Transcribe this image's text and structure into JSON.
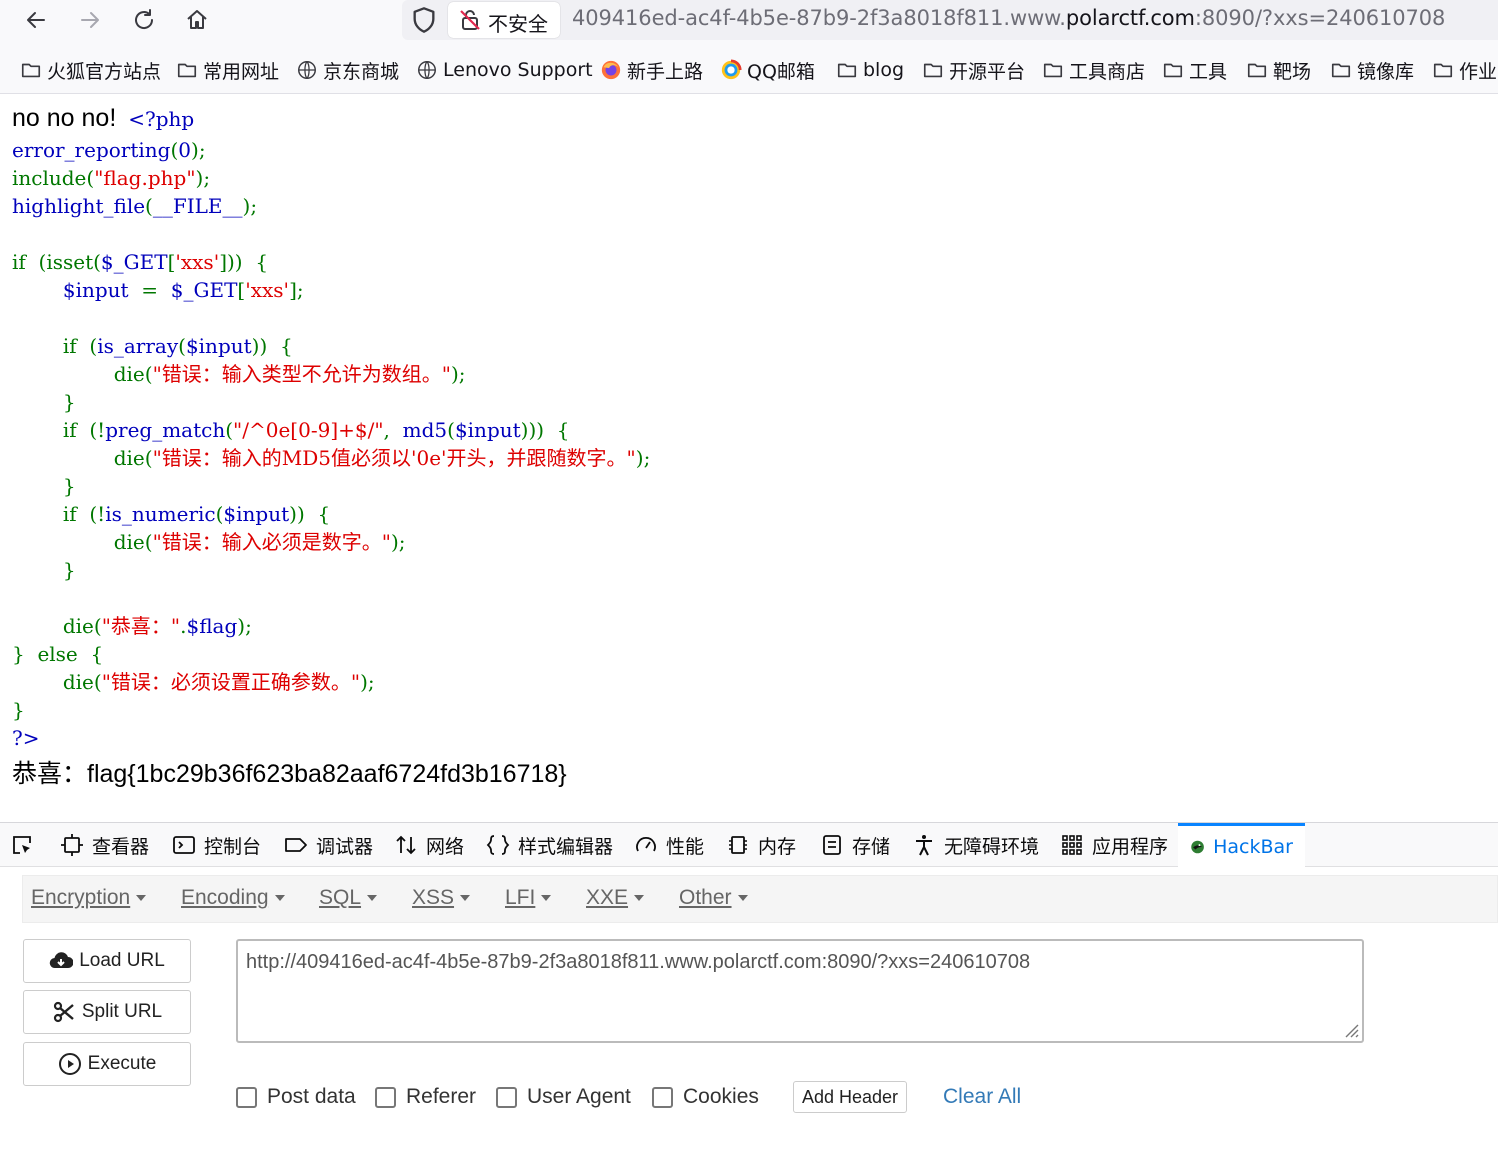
{
  "browser": {
    "security_label": "不安全",
    "url_prefix": "409416ed-ac4f-4b5e-87b9-2f3a8018f811.www.",
    "url_host": "polarctf.com",
    "url_suffix": ":8090/?xxs=240610708",
    "bookmarks": [
      {
        "label": "火狐官方站点",
        "icon": "folder-icon"
      },
      {
        "label": "常用网址",
        "icon": "folder-icon"
      },
      {
        "label": "京东商城",
        "icon": "globe-icon"
      },
      {
        "label": "Lenovo Support",
        "icon": "globe-icon"
      },
      {
        "label": "新手上路",
        "icon": "firefox-icon"
      },
      {
        "label": "QQ邮箱",
        "icon": "qq-mail-icon"
      },
      {
        "label": "blog",
        "icon": "folder-icon"
      },
      {
        "label": "开源平台",
        "icon": "folder-icon"
      },
      {
        "label": "工具商店",
        "icon": "folder-icon"
      },
      {
        "label": "工具",
        "icon": "folder-icon"
      },
      {
        "label": "靶场",
        "icon": "folder-icon"
      },
      {
        "label": "镜像库",
        "icon": "folder-icon"
      },
      {
        "label": "作业",
        "icon": "folder-icon"
      }
    ]
  },
  "page": {
    "lead": "no no no!",
    "flag_line": "恭喜：flag{1bc29b36f623ba82aaf6724fd3b16718}",
    "colors": {
      "keyword": "#0000bb",
      "operator": "#007700",
      "string": "#dd0000"
    }
  },
  "devtools": {
    "tabs": [
      {
        "label": "",
        "icon": "element-picker-icon"
      },
      {
        "label": "查看器",
        "icon": "inspector-icon"
      },
      {
        "label": "控制台",
        "icon": "console-icon"
      },
      {
        "label": "调试器",
        "icon": "debugger-icon"
      },
      {
        "label": "网络",
        "icon": "network-icon"
      },
      {
        "label": "样式编辑器",
        "icon": "style-editor-icon"
      },
      {
        "label": "性能",
        "icon": "performance-icon"
      },
      {
        "label": "内存",
        "icon": "memory-icon"
      },
      {
        "label": "存储",
        "icon": "storage-icon"
      },
      {
        "label": "无障碍环境",
        "icon": "accessibility-icon"
      },
      {
        "label": "应用程序",
        "icon": "application-icon"
      },
      {
        "label": "HackBar",
        "icon": "hackbar-icon"
      }
    ],
    "hackbar": {
      "menu": [
        "Encryption",
        "Encoding",
        "SQL",
        "XSS",
        "LFI",
        "XXE",
        "Other"
      ],
      "load_url": "Load URL",
      "split_url": "Split URL",
      "execute": "Execute",
      "url_value": "http://409416ed-ac4f-4b5e-87b9-2f3a8018f811.www.polarctf.com:8090/?xxs=240610708",
      "options": [
        "Post data",
        "Referer",
        "User Agent",
        "Cookies"
      ],
      "add_header": "Add Header",
      "clear_all": "Clear All"
    }
  }
}
